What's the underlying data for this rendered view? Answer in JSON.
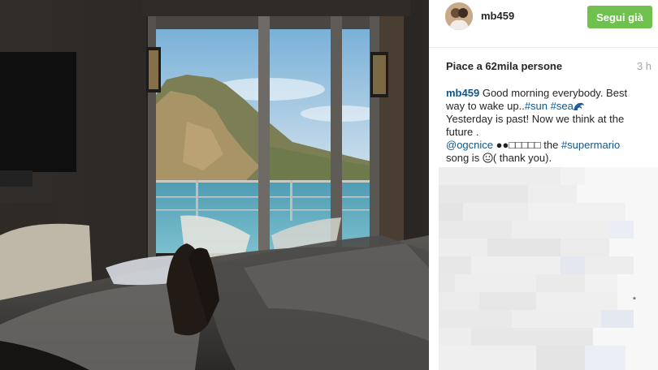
{
  "post": {
    "username": "mb459",
    "follow_button_label": "Segui già",
    "likes_text": "Piace a 62mila persone",
    "time_ago": "3 h",
    "caption": {
      "username": "mb459",
      "line1_text": "Good morning everybody. Best",
      "line2_text": "way to wake up..",
      "tag_sun": "#sun",
      "tag_sea": "#sea",
      "line3_text": "Yesterday is past! Now we think at the",
      "line4_text": "future .",
      "mention": "@ogcnice",
      "mention_after_emoji": "●●□□□□□",
      "mention_word": "the",
      "tag_supermario": "#supermario",
      "line6_prefix": "song is",
      "line6_suffix": "( thank you)."
    }
  },
  "icons": {
    "wave_emoji": "wave-icon",
    "smiley_emoji": "smiley-icon"
  },
  "colors": {
    "follow_green": "#70c050",
    "link_blue": "#125688",
    "time_gray": "#a5a7aa"
  }
}
